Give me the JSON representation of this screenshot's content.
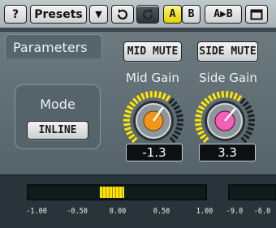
{
  "toolbar": {
    "help_label": "?",
    "presets_label": "Presets",
    "dropdown_glyph": "▼",
    "undo_icon": "undo-icon",
    "redo_icon": "redo-icon",
    "a_label": "A",
    "b_label": "B",
    "a_to_b_label": "A▶B",
    "window_icon": "window-icon",
    "active_slot": "A"
  },
  "parameters_tab": "Parameters",
  "mode": {
    "title": "Mode",
    "value": "INLINE"
  },
  "mid": {
    "mute_label": "MID MUTE",
    "gain_label": "Mid Gain",
    "value": "-1.3",
    "cap_color": "#f2951a"
  },
  "side": {
    "mute_label": "SIDE MUTE",
    "gain_label": "Side Gain",
    "value": "3.3",
    "cap_color": "#f25fb6"
  },
  "meter": {
    "scale": [
      "-1.00",
      "-0.50",
      "0.00",
      "0.50",
      "1.00"
    ],
    "scale2": [
      "-9.0",
      "-6.0"
    ],
    "correlation_level": 0.0
  },
  "colors": {
    "accent_yellow": "#ffe600"
  }
}
